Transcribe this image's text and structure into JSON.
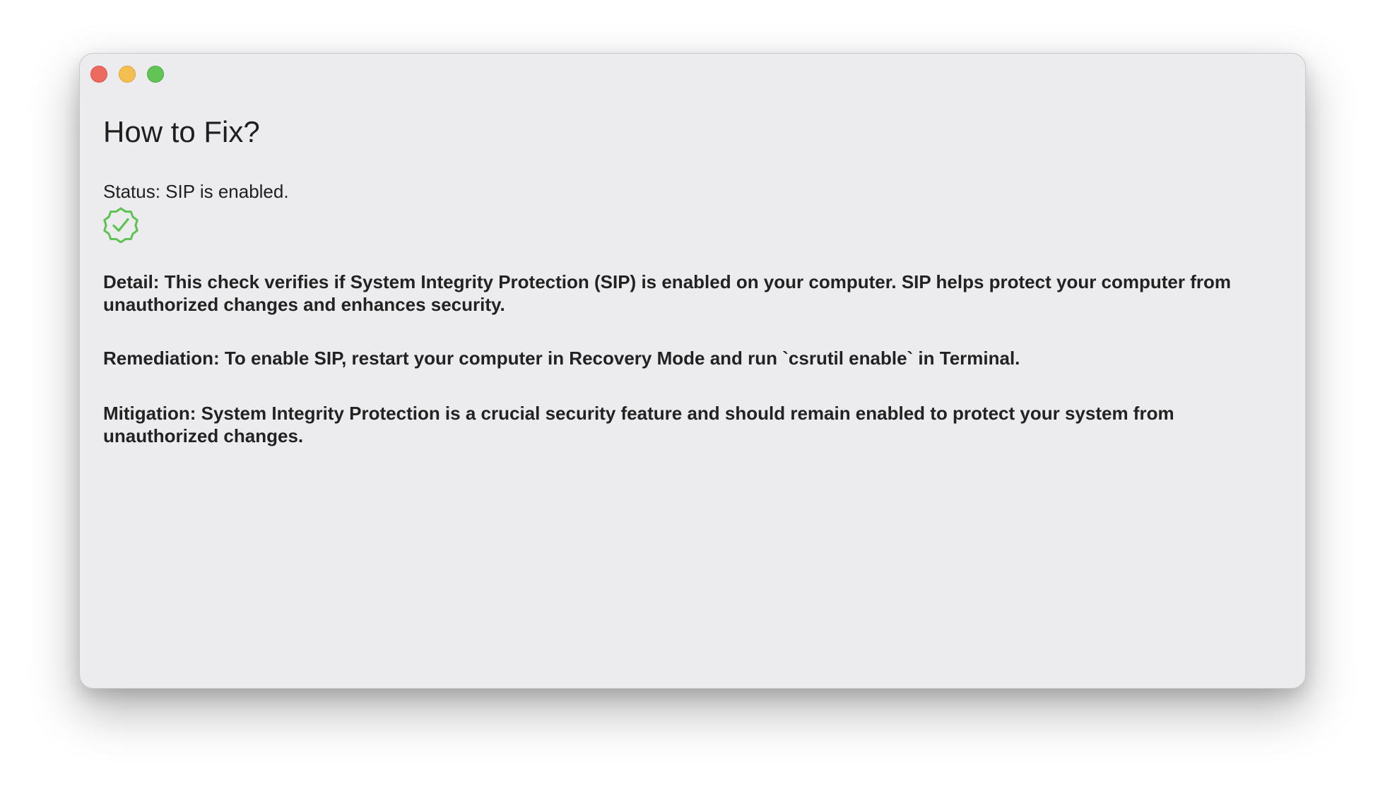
{
  "window": {
    "buttons": {
      "close": "close",
      "minimize": "minimize",
      "zoom": "zoom"
    }
  },
  "main": {
    "title": "How to Fix?",
    "status_text": "Status: SIP is enabled.",
    "status_icon": "checkmark-seal-icon",
    "status_color": "#5cc351",
    "detail": "Detail: This check verifies if System Integrity Protection (SIP) is enabled on your computer. SIP helps protect your computer from unauthorized changes and enhances security.",
    "remediation": "Remediation: To enable SIP, restart your computer in Recovery Mode and run `csrutil enable` in Terminal.",
    "mitigation": "Mitigation: System Integrity Protection is a crucial security feature and should remain enabled to protect your system from unauthorized changes."
  },
  "colors": {
    "window_bg": "#ecebee",
    "close": "#ed6a5e",
    "minimize": "#f5bf4f",
    "zoom": "#61c554",
    "text": "#1f1f1f"
  }
}
